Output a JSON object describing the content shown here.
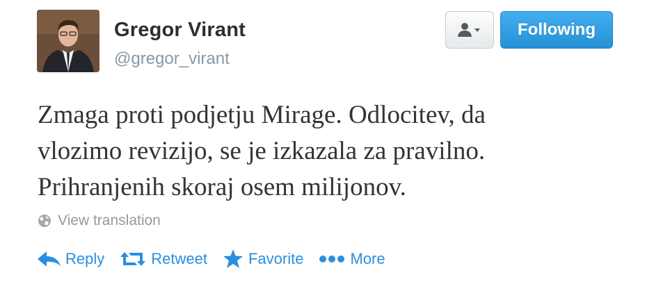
{
  "tweet": {
    "author": {
      "name": "Gregor Virant",
      "handle": "@gregor_virant"
    },
    "text_lines": [
      "Zmaga proti podjetju Mirage. Odlocitev, da",
      "vlozimo revizijo, se je izkazala za pravilno.",
      "Prihranjenih skoraj osem milijonov."
    ],
    "view_translation": "View translation",
    "actions": {
      "reply": "Reply",
      "retweet": "Retweet",
      "favorite": "Favorite",
      "more": "More"
    }
  },
  "follow_button": {
    "label": "Following"
  },
  "icons": {
    "user_dropdown": "user-dropdown-icon",
    "globe": "globe-icon",
    "reply": "reply-icon",
    "retweet": "retweet-icon",
    "favorite": "star-icon",
    "more": "more-dots-icon"
  },
  "colors": {
    "accent": "#2a8ee0",
    "follow_button": "#2f9ae3",
    "name_text": "#292f33",
    "muted_text": "#8899a6"
  }
}
